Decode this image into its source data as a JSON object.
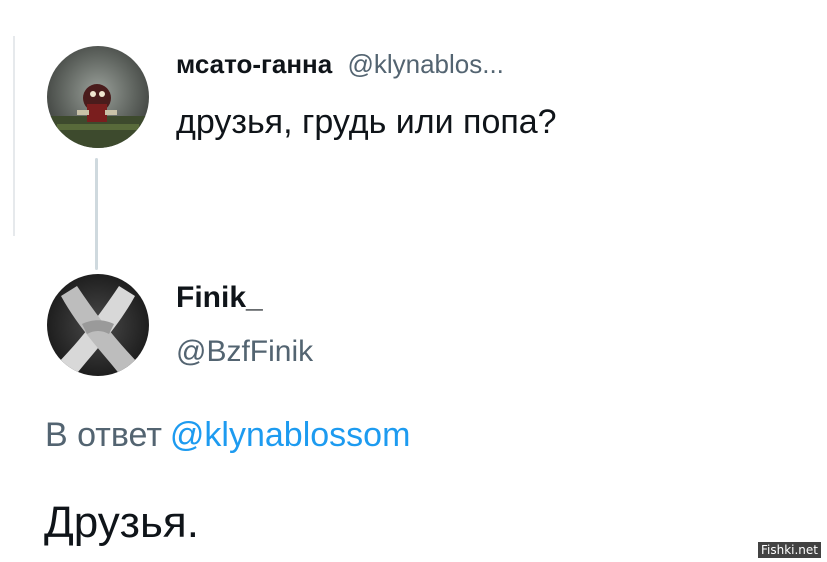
{
  "tweet1": {
    "display_name": "мсато-ганна",
    "handle": "@klynablos...",
    "text": "друзья, грудь или попа?"
  },
  "tweet2": {
    "display_name": "Finik_",
    "handle": "@BzfFinik",
    "reply_prefix": "В ответ",
    "reply_mention": "@klynablossom",
    "text": "Друзья."
  },
  "watermark": "Fishki.net",
  "colors": {
    "text": "#0f1419",
    "secondary": "#536471",
    "mention": "#1d9bf0",
    "thread_line": "#cfd9de",
    "background": "#ffffff"
  }
}
